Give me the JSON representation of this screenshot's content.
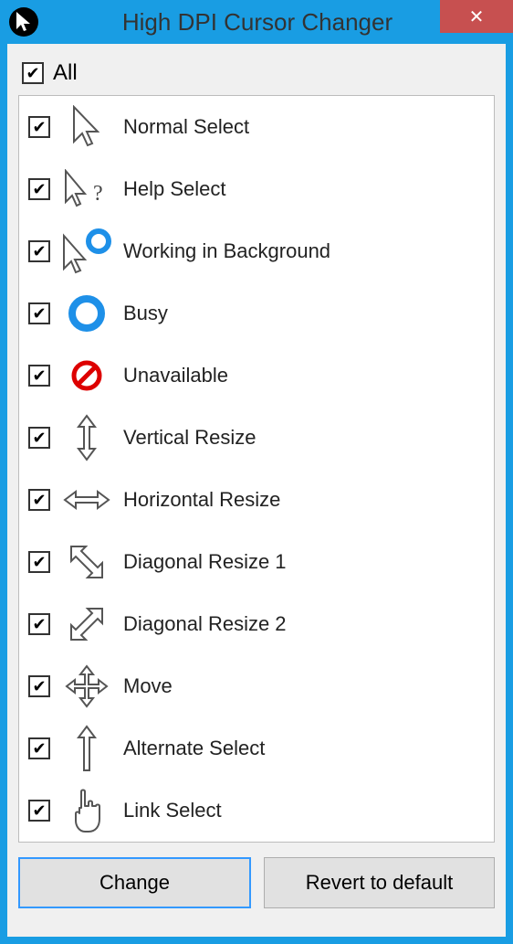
{
  "window": {
    "title": "High DPI Cursor Changer",
    "close_symbol": "✕"
  },
  "all": {
    "label": "All",
    "checked": true
  },
  "cursors": [
    {
      "checked": true,
      "label": "Normal Select",
      "icon": "cursor-normal"
    },
    {
      "checked": true,
      "label": "Help Select",
      "icon": "cursor-help"
    },
    {
      "checked": true,
      "label": "Working in Background",
      "icon": "cursor-working"
    },
    {
      "checked": true,
      "label": "Busy",
      "icon": "cursor-busy"
    },
    {
      "checked": true,
      "label": "Unavailable",
      "icon": "cursor-unavailable"
    },
    {
      "checked": true,
      "label": "Vertical Resize",
      "icon": "cursor-vresize"
    },
    {
      "checked": true,
      "label": "Horizontal Resize",
      "icon": "cursor-hresize"
    },
    {
      "checked": true,
      "label": "Diagonal Resize 1",
      "icon": "cursor-dresize1"
    },
    {
      "checked": true,
      "label": "Diagonal Resize 2",
      "icon": "cursor-dresize2"
    },
    {
      "checked": true,
      "label": "Move",
      "icon": "cursor-move"
    },
    {
      "checked": true,
      "label": "Alternate Select",
      "icon": "cursor-alt"
    },
    {
      "checked": true,
      "label": "Link Select",
      "icon": "cursor-link"
    }
  ],
  "buttons": {
    "change": "Change",
    "revert": "Revert to default"
  },
  "check_glyph": "✔"
}
